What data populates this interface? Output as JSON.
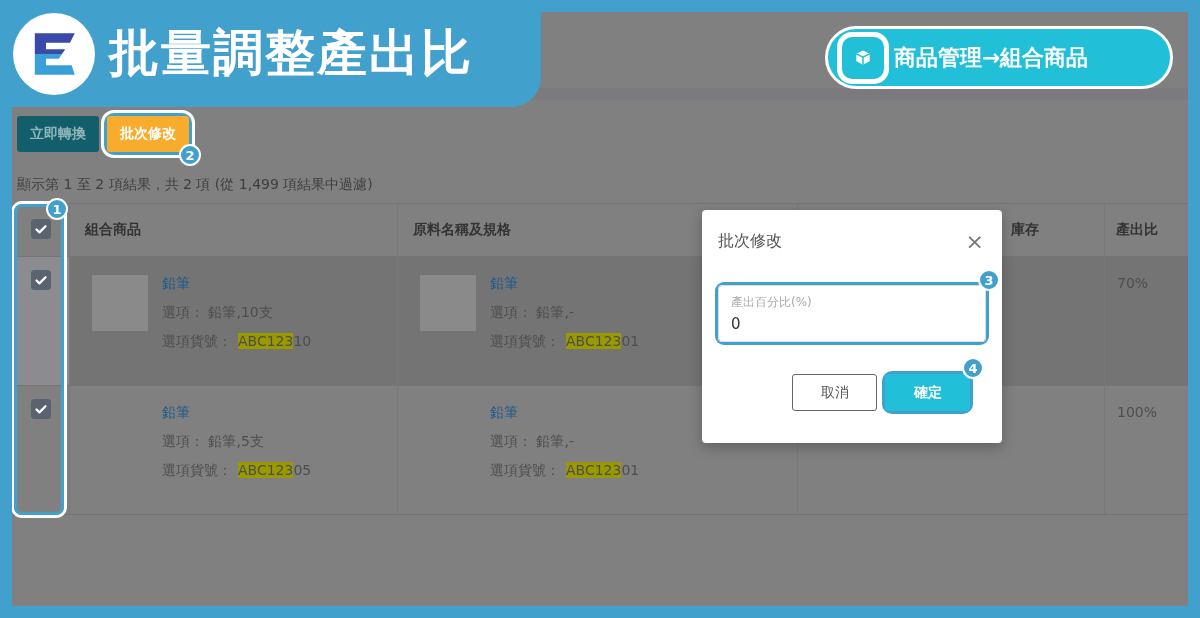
{
  "banner": {
    "title": "批量調整產出比",
    "breadcrumb": "商品管理→組合商品"
  },
  "toolbar": {
    "buttons": [
      {
        "label": "立即轉換",
        "kind": "primary"
      },
      {
        "label": "批次修改",
        "kind": "warning",
        "callout": "2"
      }
    ]
  },
  "summary": "顯示第 1 至 2 項結果，共 2 項 (從 1,499 項結果中過濾)",
  "table": {
    "header_checked": true,
    "callout": "1",
    "columns": [
      "組合商品",
      "原料名稱及規格",
      "庫存",
      "產出比"
    ],
    "rows": [
      {
        "checked": true,
        "hovered": true,
        "product": {
          "name": "鉛筆",
          "option": "選項： 鉛筆,10支",
          "sku_label": "選項貨號：",
          "sku_parts": [
            {
              "text": "ABC123",
              "highlighted": true
            },
            {
              "text": "10",
              "highlighted": false
            }
          ],
          "thumbnail": true
        },
        "material": {
          "name": "鉛筆",
          "option": "選項： 鉛筆,-",
          "sku_label": "選項貨號：",
          "sku_parts": [
            {
              "text": "ABC123",
              "highlighted": true
            },
            {
              "text": "01",
              "highlighted": false
            }
          ],
          "thumbnail": true
        },
        "ratio": "70%"
      },
      {
        "checked": true,
        "hovered": false,
        "product": {
          "name": "鉛筆",
          "option": "選項： 鉛筆,5支",
          "sku_label": "選項貨號：",
          "sku_parts": [
            {
              "text": "ABC123",
              "highlighted": true
            },
            {
              "text": "05",
              "highlighted": false
            }
          ],
          "thumbnail": false
        },
        "material": {
          "name": "鉛筆",
          "option": "選項： 鉛筆,-",
          "sku_label": "選項貨號：",
          "sku_parts": [
            {
              "text": "ABC123",
              "highlighted": true
            },
            {
              "text": "01",
              "highlighted": false
            }
          ],
          "thumbnail": false
        },
        "ratio": "100%"
      }
    ]
  },
  "dialog": {
    "title": "批次修改",
    "close": "×",
    "field": {
      "label": "產出百分比(%)",
      "value": "0",
      "callout": "3"
    },
    "buttons": [
      {
        "label": "取消",
        "kind": "secondary"
      },
      {
        "label": "確定",
        "kind": "primary",
        "callout": "4"
      }
    ]
  }
}
